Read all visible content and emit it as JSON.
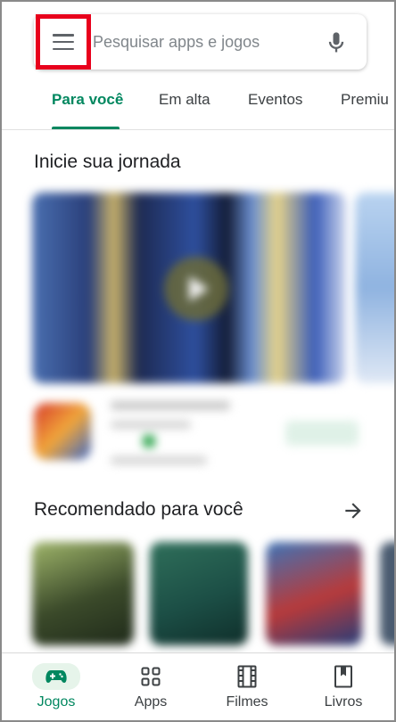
{
  "search": {
    "placeholder": "Pesquisar apps e jogos",
    "menu_icon": "hamburger-menu-icon",
    "mic_icon": "microphone-icon"
  },
  "tabs": [
    {
      "label": "Para você",
      "active": true
    },
    {
      "label": "Em alta",
      "active": false
    },
    {
      "label": "Eventos",
      "active": false
    },
    {
      "label": "Premiu",
      "active": false
    }
  ],
  "sections": {
    "journey_title": "Inicie sua jornada",
    "recommended_title": "Recomendado para você",
    "arrow_icon": "arrow-right-icon"
  },
  "bottom_nav": [
    {
      "label": "Jogos",
      "icon": "gamepad-icon",
      "active": true
    },
    {
      "label": "Apps",
      "icon": "apps-grid-icon",
      "active": false
    },
    {
      "label": "Filmes",
      "icon": "film-icon",
      "active": false
    },
    {
      "label": "Livros",
      "icon": "book-icon",
      "active": false
    }
  ],
  "colors": {
    "accent": "#01875f",
    "highlight_box": "#e8001c",
    "icon_gray": "#5f6368"
  }
}
